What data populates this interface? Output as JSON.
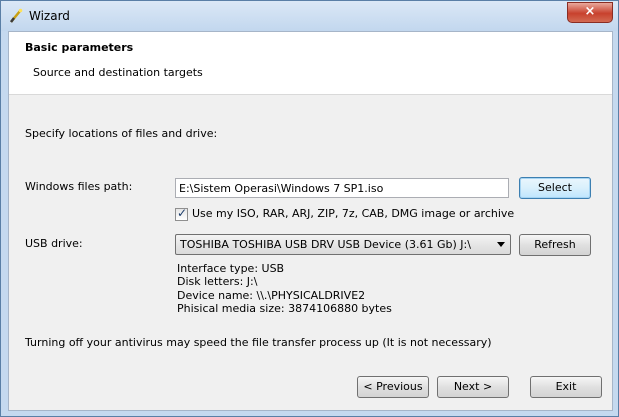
{
  "window": {
    "title": "Wizard",
    "close_glyph": "×"
  },
  "header": {
    "title": "Basic parameters",
    "subtitle": "Source and destination targets"
  },
  "instructions": "Specify locations of files and drive:",
  "windows_files": {
    "label": "Windows files path:",
    "path_value": "E:\\Sistem Operasi\\Windows 7 SP1.iso",
    "select_label": "Select"
  },
  "archive_option": {
    "checked": true,
    "label": "Use my ISO, RAR, ARJ, ZIP, 7z, CAB, DMG image or archive"
  },
  "usb": {
    "label": "USB drive:",
    "selected_drive": "TOSHIBA TOSHIBA USB DRV USB Device (3.61 Gb) J:\\",
    "refresh_label": "Refresh",
    "info": {
      "interface": "Interface type: USB",
      "disk_letters": "Disk letters: J:\\",
      "device_name": "Device name: \\\\.\\PHYSICALDRIVE2",
      "media_size": "Phisical media size: 3874106880 bytes"
    }
  },
  "antivirus_note": "Turning off your antivirus may speed the file transfer process up (It is not necessary)",
  "buttons": {
    "previous": "< Previous",
    "next": "Next >",
    "exit": "Exit"
  },
  "icons": {
    "title_icon": "wand-icon",
    "close": "close-icon",
    "dropdown": "chevron-down-icon",
    "check": "checkmark-icon"
  }
}
